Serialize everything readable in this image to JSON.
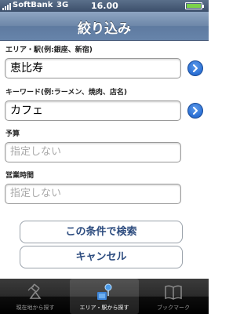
{
  "status_bar": {
    "carrier": "SoftBank",
    "network": "3G",
    "time": "16.00"
  },
  "nav": {
    "title": "絞り込み"
  },
  "form": {
    "area": {
      "label": "エリア・駅(例:銀座、新宿)",
      "value": "恵比寿"
    },
    "keyword": {
      "label": "キーワード(例:ラーメン、焼肉、店名)",
      "value": "カフェ"
    },
    "budget": {
      "label": "予算",
      "placeholder": "指定しない"
    },
    "hours": {
      "label": "営業時間",
      "placeholder": "指定しない"
    }
  },
  "buttons": {
    "search": "この条件で検索",
    "cancel": "キャンセル"
  },
  "tabs": [
    {
      "label": "現在地から探す",
      "icon": "satellite-icon",
      "selected": false
    },
    {
      "label": "エリア・駅から探す",
      "icon": "map-pin-icon",
      "selected": true
    },
    {
      "label": "ブックマーク",
      "icon": "book-icon",
      "selected": false
    }
  ],
  "colors": {
    "nav_bar": "#6d87a9",
    "button_text": "#2d4c7f",
    "disclosure": "#2a6fd4"
  }
}
